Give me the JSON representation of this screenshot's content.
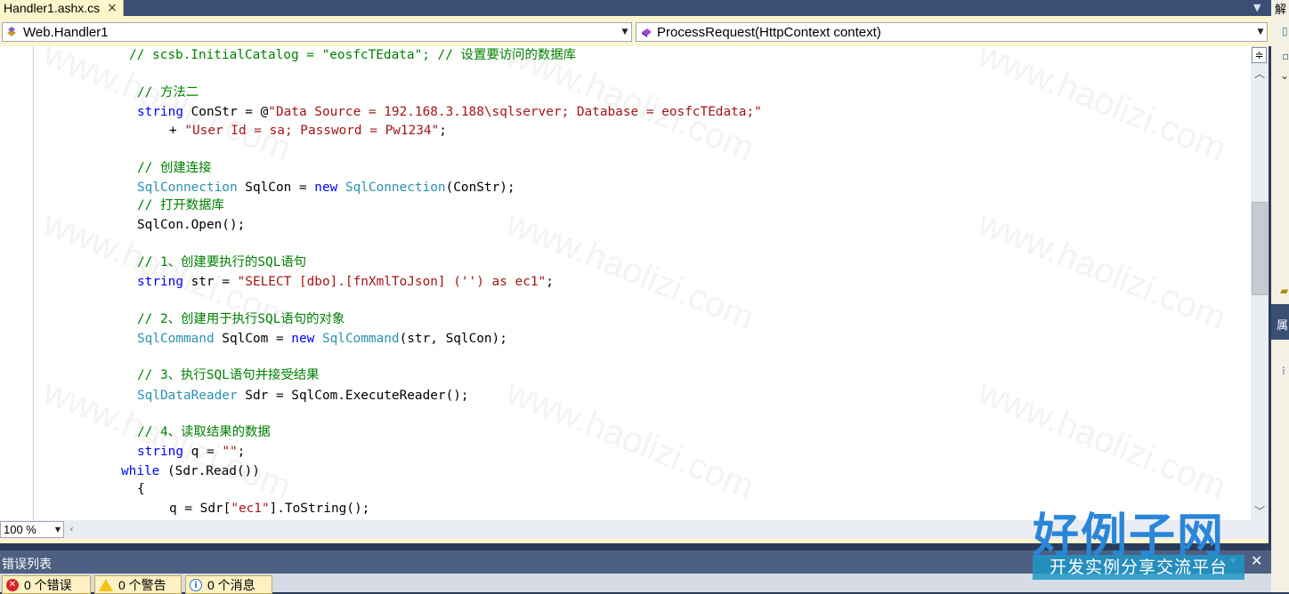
{
  "tab": {
    "title": "Handler1.ashx.cs",
    "close_glyph": "×"
  },
  "nav": {
    "class_combo": "Web.Handler1",
    "member_combo": "ProcessRequest(HttpContext context)"
  },
  "editor": {
    "zoom": "100 %",
    "lines": {
      "l1": "// scsb.InitialCatalog = \"eosfcTEdata\"; // 设置要访问的数据库",
      "l2": "// 方法二",
      "l3_kw": "string",
      "l3_rest": " ConStr = @",
      "l3_str": "\"Data Source = 192.168.3.188\\sqlserver; Database = eosfcTEdata;\"",
      "l4_plus": "+ ",
      "l4_str": "\"User Id = sa; Password = Pw1234\"",
      "l4_end": ";",
      "l5": "// 创建连接",
      "l6_ty1": "SqlConnection",
      "l6_mid": " SqlCon = ",
      "l6_kw": "new",
      "l6_sp": " ",
      "l6_ty2": "SqlConnection",
      "l6_end": "(ConStr);",
      "l7": "// 打开数据库",
      "l8": "SqlCon.Open();",
      "l9": "// 1、创建要执行的SQL语句",
      "l10_kw": "string",
      "l10_mid": " str = ",
      "l10_str": "\"SELECT [dbo].[fnXmlToJson] ('') as ec1\"",
      "l10_end": ";",
      "l11": "// 2、创建用于执行SQL语句的对象",
      "l12_ty1": "SqlCommand",
      "l12_mid": " SqlCom = ",
      "l12_kw": "new",
      "l12_sp": " ",
      "l12_ty2": "SqlCommand",
      "l12_end": "(str, SqlCon);",
      "l13": "// 3、执行SQL语句并接受结果",
      "l14_ty": "SqlDataReader",
      "l14_rest": " Sdr = SqlCom.ExecuteReader();",
      "l15": "// 4、读取结果的数据",
      "l16_kw": "string",
      "l16_mid": " q = ",
      "l16_str": "\"\"",
      "l16_end": ";",
      "l17_kw": "while",
      "l17_rest": " (Sdr.Read())",
      "l18": "{",
      "l19_a": "q = Sdr[",
      "l19_str": "\"ec1\"",
      "l19_b": "].ToString();"
    }
  },
  "side_panel": {
    "title_top": "解",
    "title_mid": "属"
  },
  "error_list": {
    "title": "错误列表",
    "errors": "0 个错误",
    "warnings": "0 个警告",
    "messages": "0 个消息"
  },
  "watermark": {
    "text": "www.haolizi.com",
    "logo_main": "好例子网",
    "logo_sub": "开发实例分享交流平台"
  }
}
